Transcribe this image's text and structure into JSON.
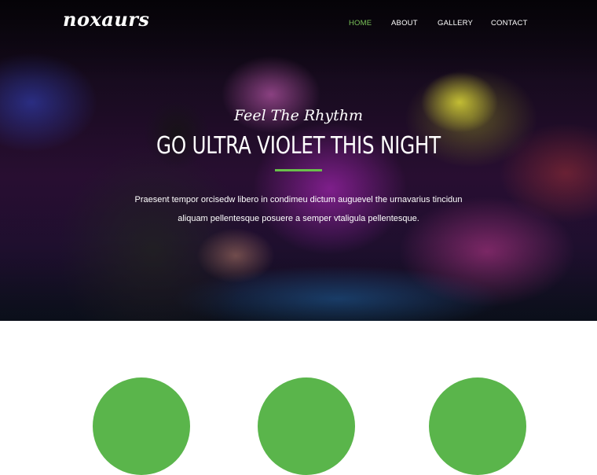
{
  "brand": {
    "logo": "noxaurs"
  },
  "nav": {
    "items": [
      {
        "label": "HOME",
        "active": true
      },
      {
        "label": "ABOUT",
        "active": false
      },
      {
        "label": "GALLERY",
        "active": false
      },
      {
        "label": "CONTACT",
        "active": false
      }
    ]
  },
  "hero": {
    "tagline": "Feel The Rhythm",
    "headline": "GO ULTRA VIOLET THIS NIGHT",
    "description_line1": "Praesent tempor orcisedw libero in condimeu dictum auguevel the urnavarius tincidun",
    "description_line2": "aliquam pellentesque posuere a semper vtaligula pellentesque."
  },
  "colors": {
    "accent": "#6abf4b",
    "active_nav": "#7bc45a",
    "feature_circle": "#5ab54b"
  },
  "features": {
    "circle_count": 3
  }
}
